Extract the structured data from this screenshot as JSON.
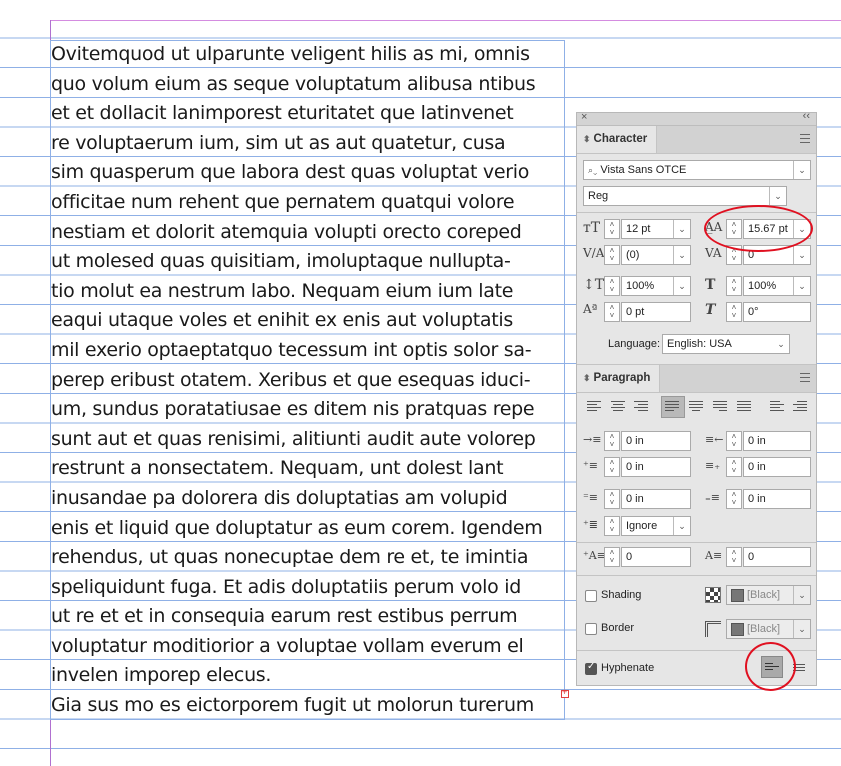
{
  "story": {
    "lines": [
      "Ovitemquod ut ulparunte veligent hilis as mi, omnis",
      "quo volum eium as seque voluptatum alibusa ntibus",
      "et et dollacit lanimporest eturitatet que latinvenet",
      "re voluptaerum ium, sim ut as aut quatetur, cusa",
      "sim quasperum que labora dest quas voluptat verio",
      "officitae num rehent que pernatem quatqui volore",
      "nestiam et dolorit atemquia volupti orecto coreped",
      "ut molesed quas quisitiam, imoluptaque nullupta-",
      "tio molut ea nestrum labo. Nequam eium ium late",
      "eaqui utaque voles et enihit ex enis aut voluptatis",
      "mil exerio optaeptatquo tecessum int optis solor sa-",
      "perep eribust otatem. Xeribus et que esequas iduci-",
      "um, sundus poratatiusae es ditem nis pratquas repe",
      "sunt aut et quas renisimi, alitiunti audit aute volorep",
      "restrunt a nonsectatem. Nequam, unt dolest lant",
      "inusandae pa dolorera dis doluptatias am volupid",
      "enis et liquid que doluptatur as eum corem. Igendem",
      "rehendus, ut quas nonecuptae dem re et, te imintia",
      "speliquidunt fuga. Et adis doluptatiis perum volo id",
      "ut re et et in consequia earum rest estibus perrum",
      "voluptatur moditiorior a voluptae vollam everum el",
      "invelen imporep elecus.",
      "Gia sus mo es eictorporem fugit ut molorun turerum"
    ]
  },
  "panel": {
    "close_glyph": "×",
    "collapse_glyph": "‹‹",
    "character": {
      "tab_label": "Character",
      "font_family": "Vista Sans OTCE",
      "font_style": "Reg",
      "font_size": "12 pt",
      "leading": "15.67 pt",
      "kerning": "(0)",
      "tracking": "0",
      "vertical_scale": "100%",
      "horizontal_scale": "100%",
      "baseline_shift": "0 pt",
      "skew": "0°",
      "language_label": "Language:",
      "language": "English: USA"
    },
    "paragraph": {
      "tab_label": "Paragraph",
      "left_indent": "0 in",
      "right_indent": "0 in",
      "first_line_indent": "0 in",
      "last_line_indent": "0 in",
      "space_before": "0 in",
      "space_after": "0 in",
      "align_to_grid": "Ignore",
      "drop_cap_lines": "0",
      "drop_cap_chars": "0",
      "shading_label": "Shading",
      "shading_color": "[Black]",
      "border_label": "Border",
      "border_color": "[Black]",
      "hyphenate_label": "Hyphenate"
    }
  },
  "colors": {
    "annotation_red": "#e01020",
    "baseline_grid": "#8fb0e6",
    "margin_guide": "#b070d0"
  }
}
